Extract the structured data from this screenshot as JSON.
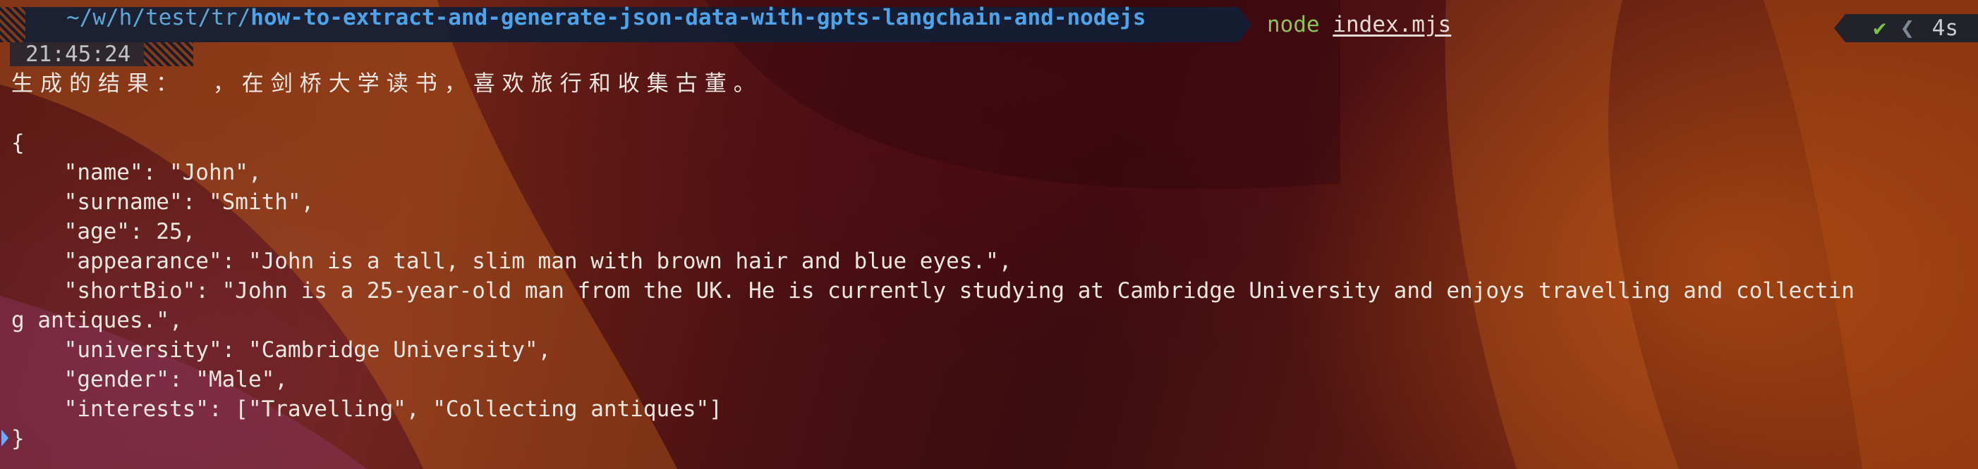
{
  "prompt": {
    "path_dim": "~/w/h/test/tr/",
    "path_bold": "how-to-extract-and-generate-json-data-with-gpts-langchain-and-nodejs",
    "command": "node",
    "argument": "index.mjs"
  },
  "status": {
    "ok_symbol": "✔",
    "separator": "❮",
    "duration": "4s",
    "colors": {
      "ok": "#7fc242",
      "command": "#8ec15a",
      "path": "#4fa3ea"
    }
  },
  "time": "21:45:24",
  "output": {
    "heading": "生成的结果：  ，在剑桥大学读书，喜欢旅行和收集古董。",
    "blank": "",
    "lines": [
      "{",
      "    \"name\": \"John\",",
      "    \"surname\": \"Smith\",",
      "    \"age\": 25,",
      "    \"appearance\": \"John is a tall, slim man with brown hair and blue eyes.\",",
      "    \"shortBio\": \"John is a 25-year-old man from the UK. He is currently studying at Cambridge University and enjoys travelling and collectin",
      "g antiques.\",",
      "    \"university\": \"Cambridge University\",",
      "    \"gender\": \"Male\",",
      "    \"interests\": [\"Travelling\", \"Collecting antiques\"]",
      "}"
    ]
  }
}
